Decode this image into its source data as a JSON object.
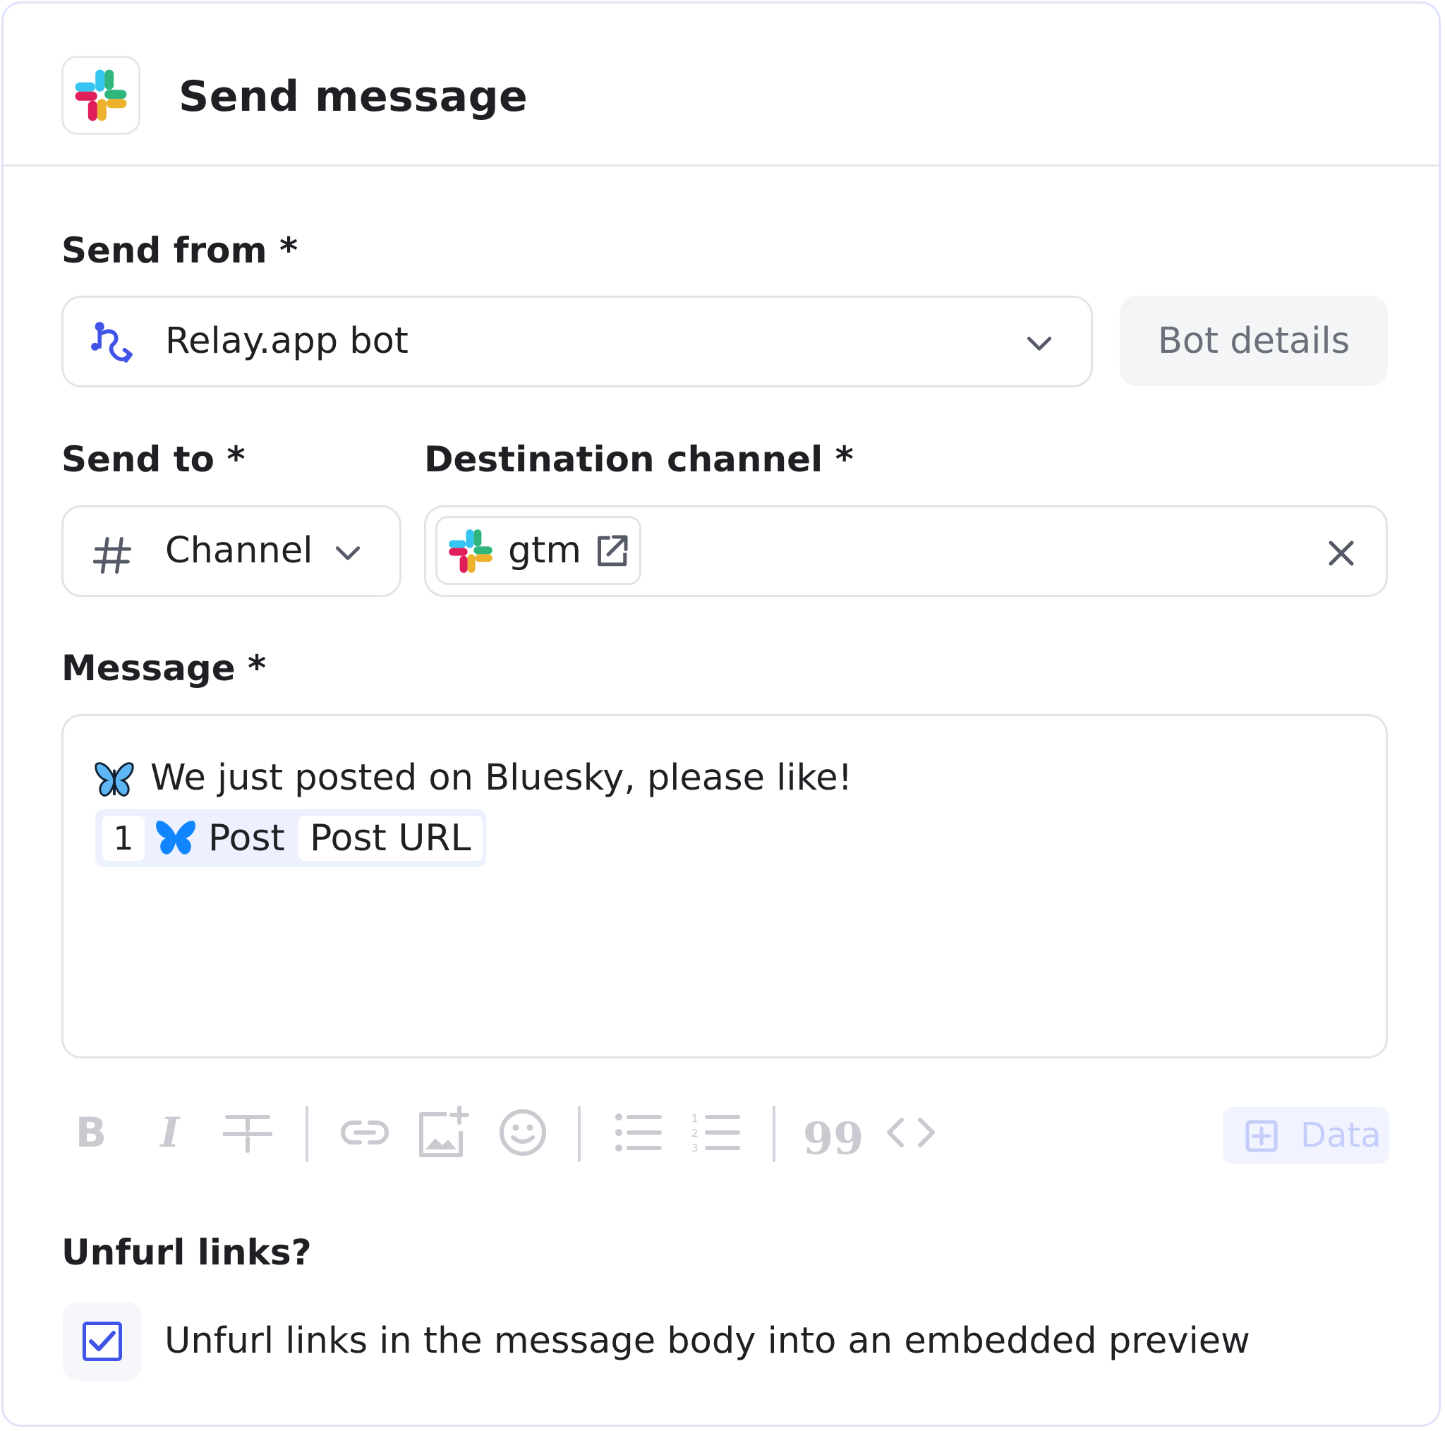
{
  "header": {
    "title": "Send message",
    "app_icon": "slack-logo"
  },
  "send_from": {
    "label": "Send from *",
    "value": "Relay.app bot",
    "icon": "relay-logo",
    "button": "Bot details"
  },
  "send_to": {
    "label": "Send to *",
    "value": "Channel",
    "icon": "hash-icon"
  },
  "destination": {
    "label": "Destination channel *",
    "chip": "gtm"
  },
  "message": {
    "label": "Message *",
    "line1_emoji": "🦋",
    "line1_text": "We just posted on Bluesky,  please like!",
    "token_step": "1",
    "token_source": "Post",
    "token_field": "Post URL"
  },
  "toolbar": {
    "items": [
      "bold",
      "italic",
      "strikethrough",
      "link",
      "image",
      "emoji",
      "bullet-list",
      "numbered-list",
      "quote",
      "code"
    ],
    "data_button": "Data"
  },
  "unfurl": {
    "label": "Unfurl links?",
    "checkbox_text": "Unfurl links in the message body into an embedded preview",
    "checked": true
  },
  "colors": {
    "accent": "#4055e8",
    "border": "#e3e4e8",
    "slack_blue": "#36c5f0",
    "slack_green": "#2eb67d",
    "slack_yellow": "#ecb22e",
    "slack_red": "#e01e5a",
    "bluesky": "#1185fe"
  }
}
